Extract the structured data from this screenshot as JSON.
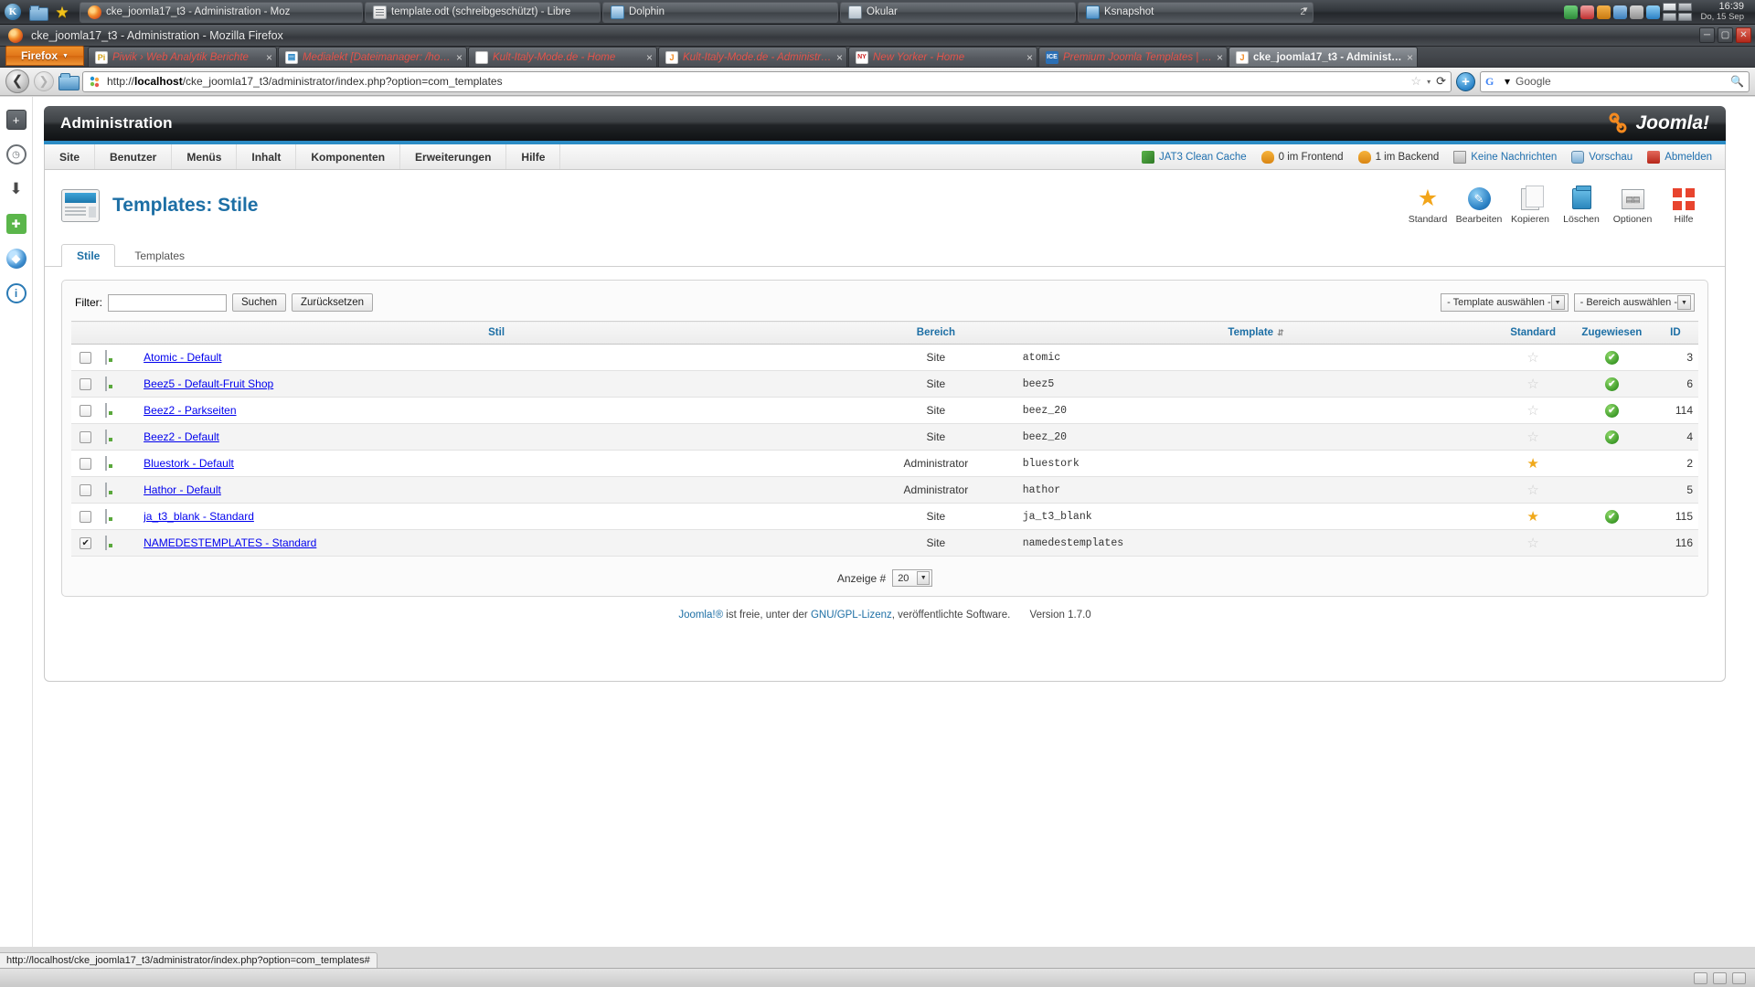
{
  "desktop": {
    "launcher_icon": "k-menu-icon",
    "quicklaunch_icon": "folder-icon",
    "taskbar_items": [
      {
        "label": "cke_joomla17_t3 - Administration - Moz",
        "icon": "firefox-icon",
        "count": ""
      },
      {
        "label": "template.odt (schreibgeschützt) - Libre",
        "icon": "writer-document-icon",
        "count": ""
      },
      {
        "label": "Dolphin",
        "icon": "dolphin-icon",
        "count": ""
      },
      {
        "label": "Okular",
        "icon": "okular-icon",
        "count": ""
      },
      {
        "label": "Ksnapshot",
        "icon": "ksnapshot-icon",
        "count": "2"
      }
    ],
    "clock_time": "16:39",
    "clock_date": "Do, 15 Sep"
  },
  "browser": {
    "window_title": "cke_joomla17_t3 - Administration - Mozilla Firefox",
    "app_button": "Firefox",
    "tabs": [
      {
        "label": "Piwik › Web Analytik Berichte",
        "favicon": "piwik-icon",
        "active": false
      },
      {
        "label": "Medialekt [Dateimanager: /hom...",
        "favicon": "medialekt-icon",
        "active": false
      },
      {
        "label": "Kult-Italy-Mode.de - Home",
        "favicon": "document-icon",
        "active": false
      },
      {
        "label": "Kult-Italy-Mode.de - Administrat...",
        "favicon": "joomla-icon",
        "active": false
      },
      {
        "label": "New Yorker - Home",
        "favicon": "newyorker-icon",
        "active": false
      },
      {
        "label": "Premium Joomla Templates | Joo...",
        "favicon": "ice-icon",
        "active": false
      },
      {
        "label": "cke_joomla17_t3 - Administrat...",
        "favicon": "joomla-icon",
        "active": true
      }
    ],
    "url_prefix": "http://",
    "url_host": "localhost",
    "url_path": "/cke_joomla17_t3/administrator/index.php?option=com_templates",
    "search_placeholder": "Google",
    "back_icon": "back-arrow-icon",
    "forward_icon": "forward-arrow-icon",
    "reload_icon": "reload-icon",
    "bookmark_icon": "star-icon",
    "statusbar_url": "http://localhost/cke_joomla17_t3/administrator/index.php?option=com_templates#"
  },
  "sidebar_rail": [
    {
      "name": "add-icon"
    },
    {
      "name": "history-clock-icon"
    },
    {
      "name": "download-arrow-icon"
    },
    {
      "name": "addon-puzzle-icon"
    },
    {
      "name": "firefox-sync-icon"
    },
    {
      "name": "info-icon"
    }
  ],
  "joomla": {
    "header_title": "Administration",
    "logo_text": "Joomla!",
    "menu": [
      "Site",
      "Benutzer",
      "Menüs",
      "Inhalt",
      "Komponenten",
      "Erweiterungen",
      "Hilfe"
    ],
    "status_items": [
      {
        "label": "JAT3 Clean Cache",
        "icon": "cache-icon",
        "link": true
      },
      {
        "label": "0 im Frontend",
        "icon": "user-icon",
        "link": false
      },
      {
        "label": "1 im Backend",
        "icon": "user-icon",
        "link": false
      },
      {
        "label": "Keine Nachrichten",
        "icon": "mail-icon",
        "link": true
      },
      {
        "label": "Vorschau",
        "icon": "eye-icon",
        "link": true
      },
      {
        "label": "Abmelden",
        "icon": "logout-icon",
        "link": true
      }
    ],
    "page_title": "Templates: Stile",
    "page_icon": "templates-icon",
    "toolbar": [
      {
        "label": "Standard",
        "icon": "star-icon"
      },
      {
        "label": "Bearbeiten",
        "icon": "pencil-icon"
      },
      {
        "label": "Kopieren",
        "icon": "copy-icon"
      },
      {
        "label": "Löschen",
        "icon": "trash-icon"
      },
      {
        "label": "Optionen",
        "icon": "options-icon"
      },
      {
        "label": "Hilfe",
        "icon": "help-icon"
      }
    ],
    "subtabs": [
      {
        "label": "Stile",
        "active": true
      },
      {
        "label": "Templates",
        "active": false
      }
    ],
    "filter": {
      "label": "Filter:",
      "value": "",
      "search_button": "Suchen",
      "reset_button": "Zurücksetzen",
      "template_select": "- Template auswählen -",
      "area_select": "- Bereich auswählen -"
    },
    "table": {
      "columns": {
        "checkbox": "",
        "style": "Stil",
        "area": "Bereich",
        "template": "Template",
        "default": "Standard",
        "assigned": "Zugewiesen",
        "id": "ID"
      },
      "sort_column": "Template",
      "sort_icon": "sort-asc-icon",
      "rows": [
        {
          "checked": false,
          "style": "Atomic - Default",
          "area": "Site",
          "template": "atomic",
          "default": false,
          "assigned": true,
          "id": "3"
        },
        {
          "checked": false,
          "style": "Beez5 - Default-Fruit Shop",
          "area": "Site",
          "template": "beez5",
          "default": false,
          "assigned": true,
          "id": "6"
        },
        {
          "checked": false,
          "style": "Beez2 - Parkseiten",
          "area": "Site",
          "template": "beez_20",
          "default": false,
          "assigned": true,
          "id": "114"
        },
        {
          "checked": false,
          "style": "Beez2 - Default",
          "area": "Site",
          "template": "beez_20",
          "default": false,
          "assigned": true,
          "id": "4"
        },
        {
          "checked": false,
          "style": "Bluestork - Default",
          "area": "Administrator",
          "template": "bluestork",
          "default": true,
          "assigned": false,
          "id": "2"
        },
        {
          "checked": false,
          "style": "Hathor - Default",
          "area": "Administrator",
          "template": "hathor",
          "default": false,
          "assigned": false,
          "id": "5"
        },
        {
          "checked": false,
          "style": "ja_t3_blank - Standard",
          "area": "Site",
          "template": "ja_t3_blank",
          "default": true,
          "assigned": true,
          "id": "115"
        },
        {
          "checked": true,
          "style": "NAMEDESTEMPLATES - Standard",
          "area": "Site",
          "template": "namedestemplates",
          "default": false,
          "assigned": false,
          "id": "116"
        }
      ]
    },
    "pagination": {
      "label": "Anzeige #",
      "limit": "20"
    },
    "footer": {
      "brand": "Joomla!®",
      "text_before": " ist freie, unter der ",
      "license": "GNU/GPL-Lizenz",
      "text_after": ", veröffentlichte Software.",
      "version": "Version 1.7.0"
    }
  }
}
